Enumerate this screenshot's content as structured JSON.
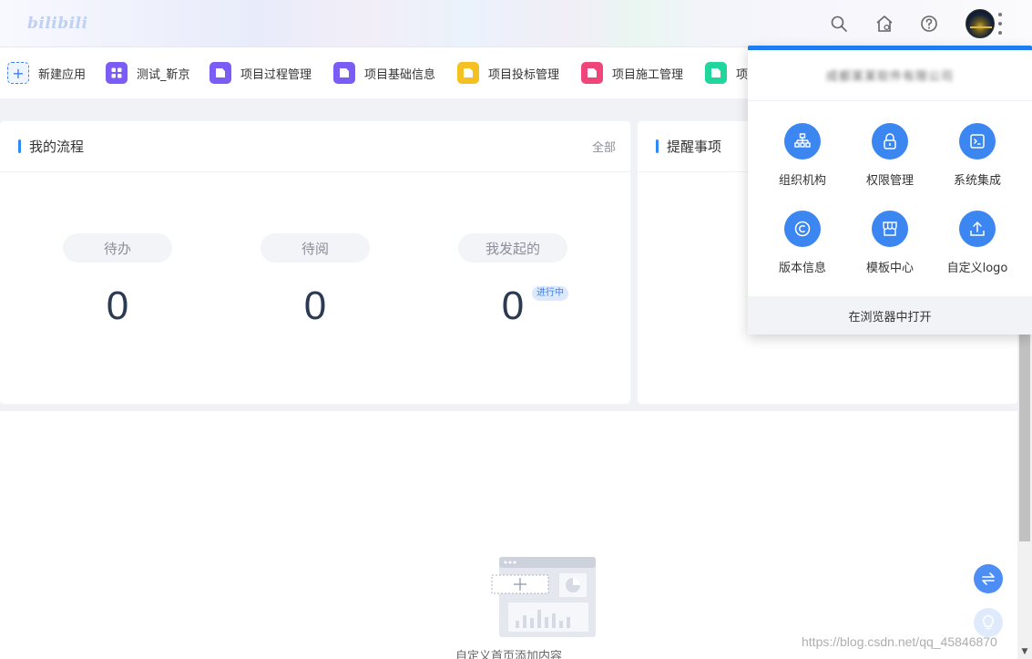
{
  "header": {
    "logo_text": "bilibili",
    "icons": [
      "search-icon",
      "home-icon",
      "help-icon"
    ]
  },
  "apps": [
    {
      "label": "新建应用",
      "icon": "plus-icon",
      "color": "#3c7ff0"
    },
    {
      "label": "测试_靳京",
      "icon": "grid-app-icon",
      "color": "#7b5cf5"
    },
    {
      "label": "项目过程管理",
      "icon": "doc-app-icon",
      "color": "#7b5cf5"
    },
    {
      "label": "项目基础信息",
      "icon": "doc-app-icon",
      "color": "#7b5cf5"
    },
    {
      "label": "项目投标管理",
      "icon": "doc-app-icon",
      "color": "#f5c021"
    },
    {
      "label": "项目施工管理",
      "icon": "doc-app-icon",
      "color": "#f0457a"
    },
    {
      "label": "项",
      "icon": "doc-app-icon",
      "color": "#20d69c"
    }
  ],
  "flow_card": {
    "title": "我的流程",
    "more": "全部",
    "stats": [
      {
        "label": "待办",
        "value": "0"
      },
      {
        "label": "待阅",
        "value": "0"
      },
      {
        "label": "我发起的",
        "value": "0",
        "badge": "进行中"
      }
    ]
  },
  "reminder_card": {
    "title": "提醒事项"
  },
  "bottom": {
    "empty_text": "自定义首页添加内容"
  },
  "dropdown": {
    "org_name": "成都某某软件有限公司",
    "items": [
      {
        "label": "组织机构",
        "icon": "org-chart-icon"
      },
      {
        "label": "权限管理",
        "icon": "lock-icon"
      },
      {
        "label": "系统集成",
        "icon": "terminal-icon"
      },
      {
        "label": "版本信息",
        "icon": "copyright-icon"
      },
      {
        "label": "模板中心",
        "icon": "store-icon"
      },
      {
        "label": "自定义logo",
        "icon": "upload-icon"
      }
    ],
    "footer": "在浏览器中打开"
  },
  "watermark": "https://blog.csdn.net/qq_45846870",
  "colors": {
    "accent": "#2f8bf7",
    "panel_top": "#1d7cf2",
    "icon_circle": "#3c86f2"
  }
}
